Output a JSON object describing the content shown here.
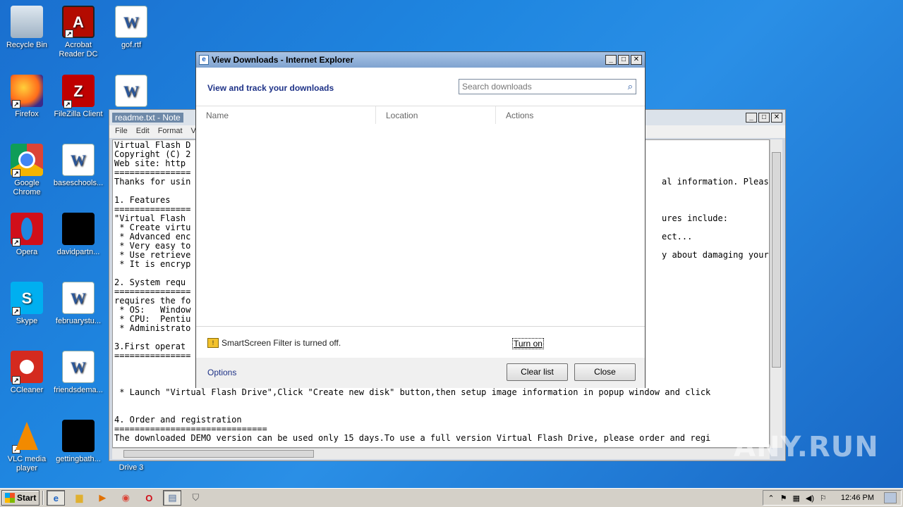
{
  "desktop": {
    "icons": [
      {
        "label": "Recycle Bin",
        "icon": "recycle-bin-icon"
      },
      {
        "label": "Acrobat Reader DC",
        "icon": "acrobat-icon"
      },
      {
        "label": "gof.rtf",
        "icon": "word-document-icon"
      },
      {
        "label": "Firefox",
        "icon": "firefox-icon"
      },
      {
        "label": "FileZilla Client",
        "icon": "filezilla-icon"
      },
      {
        "label": "",
        "icon": "word-document-icon"
      },
      {
        "label": "Google Chrome",
        "icon": "chrome-icon"
      },
      {
        "label": "baseschools...",
        "icon": "word-document-icon"
      },
      {
        "label": "Opera",
        "icon": "opera-icon"
      },
      {
        "label": "davidpartn...",
        "icon": "black-file-icon"
      },
      {
        "label": "Skype",
        "icon": "skype-icon"
      },
      {
        "label": "februarystu...",
        "icon": "word-document-icon"
      },
      {
        "label": "CCleaner",
        "icon": "ccleaner-icon"
      },
      {
        "label": "friendsdema...",
        "icon": "word-document-icon"
      },
      {
        "label": "VLC media player",
        "icon": "vlc-icon"
      },
      {
        "label": "gettingbath...",
        "icon": "black-file-icon"
      },
      {
        "label": "Drive 3",
        "icon": ""
      }
    ]
  },
  "notepad": {
    "title": "readme.txt - Note",
    "menu": [
      "File",
      "Edit",
      "Format",
      "Vi"
    ],
    "left_lines": "Virtual Flash D\nCopyright (C) 2\nWeb site: http\n===============\nThanks for usin\n\n1. Features\n===============\n\"Virtual Flash \n * Create virtu\n * Advanced enc\n * Very easy to\n * Use retrieve\n * It is encryp\n\n2. System requ\n===============\nrequires the fo\n * OS:   Window\n * CPU:  Pentiu\n * Administrato\n\n3.First operat\n===============",
    "right_lines": "\n\n\n\nal information. Please\n\n\n\nures include:\n\nect...\n\ny about damaging your\n",
    "line_launch": " * Launch \"Virtual Flash Drive\",Click \"Create new disk\" button,then setup image information in popup window and click",
    "section4": "4. Order and registration",
    "section4_rule": "==============================",
    "last_line": "The downloaded DEMO version can be used only 15 days.To use a full version Virtual Flash Drive, please order and regi"
  },
  "downloads": {
    "title": "View Downloads - Internet Explorer",
    "heading": "View and track your downloads",
    "search_placeholder": "Search downloads",
    "columns": [
      "Name",
      "Location",
      "Actions"
    ],
    "smartscreen_text": "SmartScreen Filter is turned off.",
    "turn_on": "Turn on",
    "options": "Options",
    "clear_list": "Clear list",
    "close": "Close"
  },
  "taskbar": {
    "start": "Start",
    "clock": "12:46 PM"
  },
  "watermark": "ANY.RUN"
}
